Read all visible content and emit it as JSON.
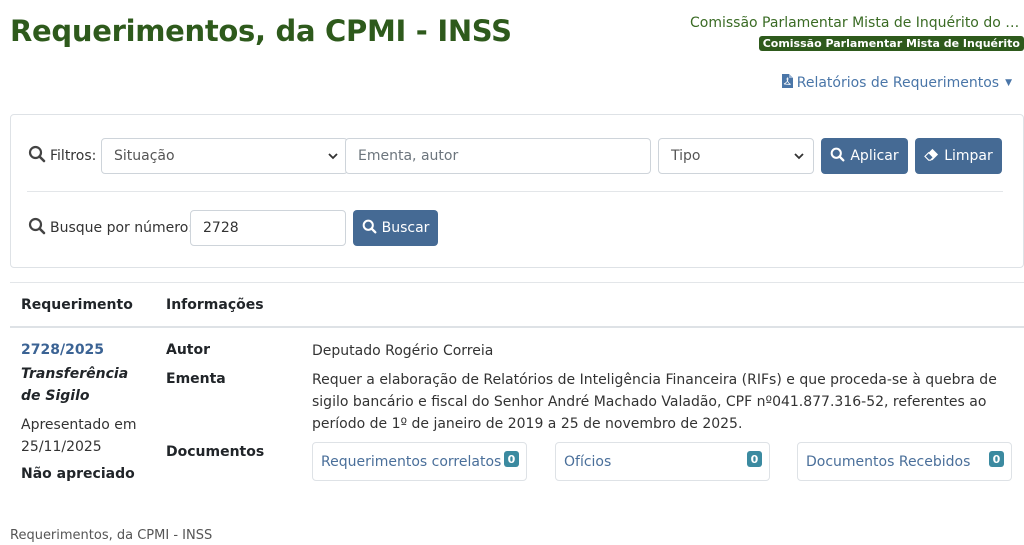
{
  "header": {
    "title": "Requerimentos, da CPMI - INSS",
    "commission_name": "Comissão Parlamentar Mista de Inquérito do IN...",
    "commission_badge": "Comissão Parlamentar Mista de Inquérito",
    "reports_label": "Relatórios de Requerimentos"
  },
  "filters": {
    "label": "Filtros:",
    "situacao_value": "Situação",
    "search_placeholder": "Ementa, autor",
    "tipo_value": "Tipo",
    "apply_label": "Aplicar",
    "clear_label": "Limpar",
    "number_label": "Busque por número:",
    "number_value": "2728",
    "search_label": "Buscar"
  },
  "table": {
    "headers": [
      "Requerimento",
      "Informações"
    ],
    "row": {
      "number": "2728/2025",
      "subject": "Transferência de Sigilo",
      "presented": "Apresentado em 25/11/2025",
      "status": "Não apreciado",
      "author_label": "Autor",
      "author": "Deputado Rogério Correia",
      "ementa_label": "Ementa",
      "ementa": "Requer a elaboração de Relatórios de Inteligência Financeira (RIFs) e que proceda-se à quebra de sigilo bancário e fiscal do Senhor André Machado Valadão, CPF nº041.877.316-52, referentes ao período de 1º de janeiro de 2019 a 25 de novembro de 2025.",
      "documents_label": "Documentos",
      "documents": [
        {
          "label": "Requerimentos correlatos",
          "count": "0"
        },
        {
          "label": "Ofícios",
          "count": "0"
        },
        {
          "label": "Documentos Recebidos",
          "count": "0"
        }
      ]
    }
  },
  "footer": {
    "text": "Requerimentos, da CPMI - INSS"
  },
  "colors": {
    "title_green": "#2e5a1c",
    "button_blue": "#456a94",
    "link_blue": "#3b6394",
    "badge_teal": "#3b8aa0"
  }
}
